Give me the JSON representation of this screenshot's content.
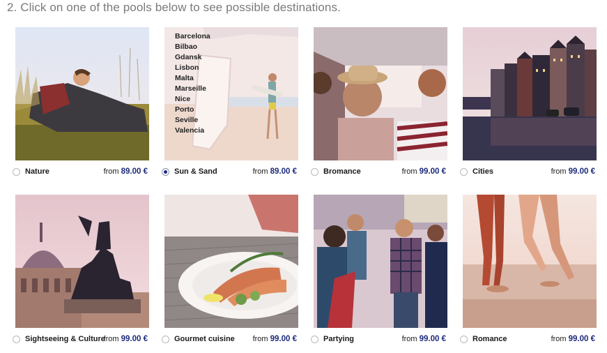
{
  "header": {
    "title": "2. Click on one of the pools below to see possible destinations."
  },
  "price_prefix": "from",
  "pools": [
    {
      "name": "Nature",
      "price": "89.00 €",
      "selected": false
    },
    {
      "name": "Sun & Sand",
      "price": "89.00 €",
      "selected": true,
      "destinations": [
        "Barcelona",
        "Bilbao",
        "Gdansk",
        "Lisbon",
        "Malta",
        "Marseille",
        "Nice",
        "Porto",
        "Seville",
        "Valencia"
      ]
    },
    {
      "name": "Bromance",
      "price": "99.00 €",
      "selected": false
    },
    {
      "name": "Cities",
      "price": "99.00 €",
      "selected": false
    },
    {
      "name": "Sightseeing & Culture",
      "price": "99.00 €",
      "selected": false
    },
    {
      "name": "Gourmet cuisine",
      "price": "99.00 €",
      "selected": false
    },
    {
      "name": "Partying",
      "price": "99.00 €",
      "selected": false
    },
    {
      "name": "Romance",
      "price": "99.00 €",
      "selected": false
    }
  ],
  "colors": {
    "price_accent": "#1c2a7a",
    "title_gray": "#7a7a7a"
  }
}
